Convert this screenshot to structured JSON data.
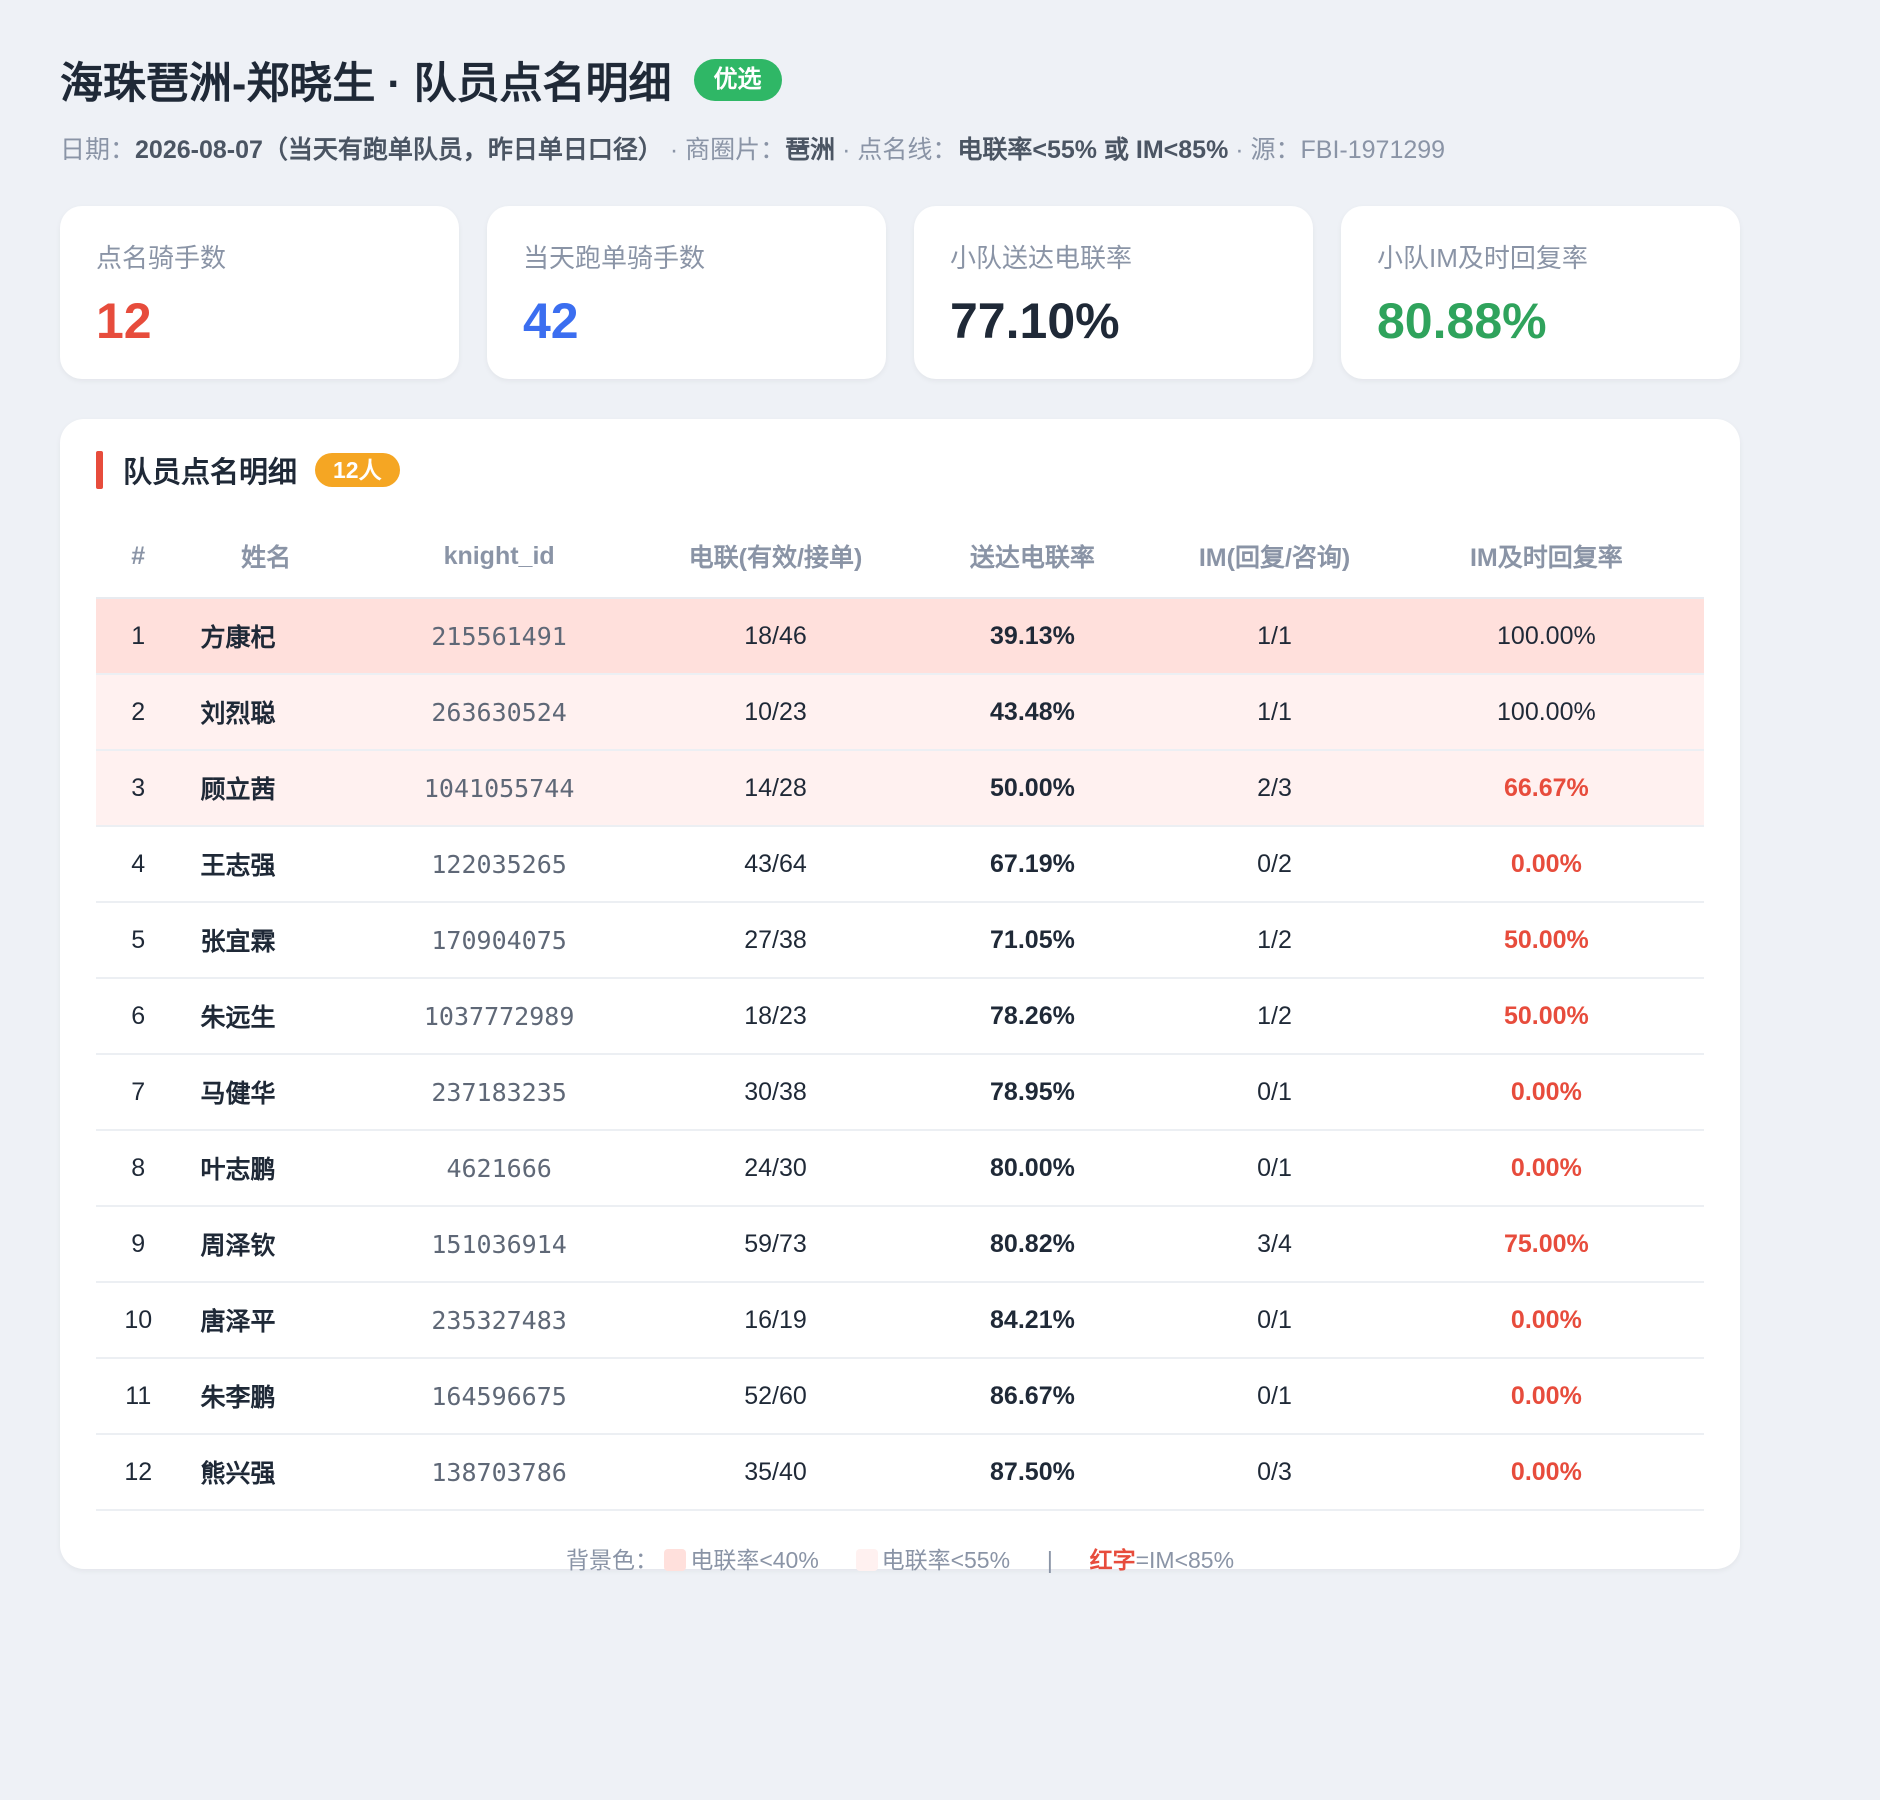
{
  "header": {
    "title": "海珠琶洲-郑晓生 · 队员点名明细",
    "badge": "优选"
  },
  "meta": {
    "date_prefix": "日期：",
    "date_value": "2026-08-07（当天有跑单队员，昨日单日口径）",
    "area_prefix": " · 商圈片：",
    "area_value": "琶洲",
    "line_prefix": " · 点名线：",
    "line_value": "电联率<55% 或 IM<85%",
    "source_prefix": " · 源：",
    "source_value": "FBI-1971299"
  },
  "kpis": [
    {
      "label": "点名骑手数",
      "value": "12",
      "color": "#e74c3c"
    },
    {
      "label": "当天跑单骑手数",
      "value": "42",
      "color": "#3b6ef0"
    },
    {
      "label": "小队送达电联率",
      "value": "77.10%",
      "color": "#1f2937"
    },
    {
      "label": "小队IM及时回复率",
      "value": "80.88%",
      "color": "#2fa35c"
    }
  ],
  "section": {
    "title": "队员点名明细",
    "count": "12人"
  },
  "table": {
    "columns": [
      "#",
      "姓名",
      "knight_id",
      "电联(有效/接单)",
      "送达电联率",
      "IM(回复/咨询)",
      "IM及时回复率"
    ],
    "rows": [
      {
        "idx": "1",
        "name": "方康杞",
        "kid": "215561491",
        "call": "18/46",
        "rate": "39.13%",
        "im": "1/1",
        "im_rate": "100.00%",
        "severity": "sev1",
        "im_red": false
      },
      {
        "idx": "2",
        "name": "刘烈聪",
        "kid": "263630524",
        "call": "10/23",
        "rate": "43.48%",
        "im": "1/1",
        "im_rate": "100.00%",
        "severity": "sev2",
        "im_red": false
      },
      {
        "idx": "3",
        "name": "顾立茜",
        "kid": "1041055744",
        "call": "14/28",
        "rate": "50.00%",
        "im": "2/3",
        "im_rate": "66.67%",
        "severity": "sev2",
        "im_red": true
      },
      {
        "idx": "4",
        "name": "王志强",
        "kid": "122035265",
        "call": "43/64",
        "rate": "67.19%",
        "im": "0/2",
        "im_rate": "0.00%",
        "severity": "",
        "im_red": true
      },
      {
        "idx": "5",
        "name": "张宜霖",
        "kid": "170904075",
        "call": "27/38",
        "rate": "71.05%",
        "im": "1/2",
        "im_rate": "50.00%",
        "severity": "",
        "im_red": true
      },
      {
        "idx": "6",
        "name": "朱远生",
        "kid": "1037772989",
        "call": "18/23",
        "rate": "78.26%",
        "im": "1/2",
        "im_rate": "50.00%",
        "severity": "",
        "im_red": true
      },
      {
        "idx": "7",
        "name": "马健华",
        "kid": "237183235",
        "call": "30/38",
        "rate": "78.95%",
        "im": "0/1",
        "im_rate": "0.00%",
        "severity": "",
        "im_red": true
      },
      {
        "idx": "8",
        "name": "叶志鹏",
        "kid": "4621666",
        "call": "24/30",
        "rate": "80.00%",
        "im": "0/1",
        "im_rate": "0.00%",
        "severity": "",
        "im_red": true
      },
      {
        "idx": "9",
        "name": "周泽钦",
        "kid": "151036914",
        "call": "59/73",
        "rate": "80.82%",
        "im": "3/4",
        "im_rate": "75.00%",
        "severity": "",
        "im_red": true
      },
      {
        "idx": "10",
        "name": "唐泽平",
        "kid": "235327483",
        "call": "16/19",
        "rate": "84.21%",
        "im": "0/1",
        "im_rate": "0.00%",
        "severity": "",
        "im_red": true
      },
      {
        "idx": "11",
        "name": "朱李鹏",
        "kid": "164596675",
        "call": "52/60",
        "rate": "86.67%",
        "im": "0/1",
        "im_rate": "0.00%",
        "severity": "",
        "im_red": true
      },
      {
        "idx": "12",
        "name": "熊兴强",
        "kid": "138703786",
        "call": "35/40",
        "rate": "87.50%",
        "im": "0/3",
        "im_rate": "0.00%",
        "severity": "",
        "im_red": true
      }
    ]
  },
  "legend": {
    "prefix": "背景色：",
    "sev1_label": "电联率<40%",
    "sev1_color": "#ffe0dc",
    "sev2_label": "电联率<55%",
    "sev2_color": "#fff1f0",
    "separator": "|",
    "red_word": "红字",
    "red_rule": "=IM<85%"
  }
}
